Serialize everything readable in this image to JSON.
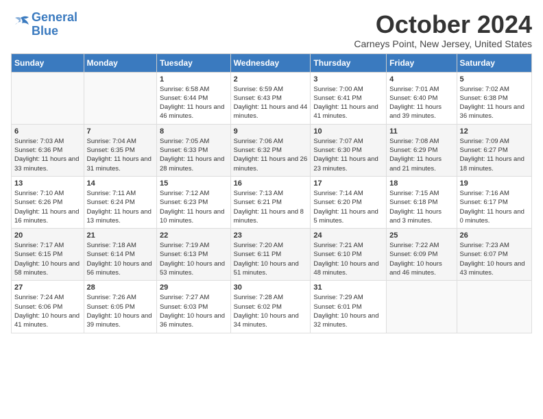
{
  "logo": {
    "line1": "General",
    "line2": "Blue"
  },
  "title": "October 2024",
  "location": "Carneys Point, New Jersey, United States",
  "days_of_week": [
    "Sunday",
    "Monday",
    "Tuesday",
    "Wednesday",
    "Thursday",
    "Friday",
    "Saturday"
  ],
  "weeks": [
    [
      {
        "day": "",
        "info": ""
      },
      {
        "day": "",
        "info": ""
      },
      {
        "day": "1",
        "info": "Sunrise: 6:58 AM\nSunset: 6:44 PM\nDaylight: 11 hours and 46 minutes."
      },
      {
        "day": "2",
        "info": "Sunrise: 6:59 AM\nSunset: 6:43 PM\nDaylight: 11 hours and 44 minutes."
      },
      {
        "day": "3",
        "info": "Sunrise: 7:00 AM\nSunset: 6:41 PM\nDaylight: 11 hours and 41 minutes."
      },
      {
        "day": "4",
        "info": "Sunrise: 7:01 AM\nSunset: 6:40 PM\nDaylight: 11 hours and 39 minutes."
      },
      {
        "day": "5",
        "info": "Sunrise: 7:02 AM\nSunset: 6:38 PM\nDaylight: 11 hours and 36 minutes."
      }
    ],
    [
      {
        "day": "6",
        "info": "Sunrise: 7:03 AM\nSunset: 6:36 PM\nDaylight: 11 hours and 33 minutes."
      },
      {
        "day": "7",
        "info": "Sunrise: 7:04 AM\nSunset: 6:35 PM\nDaylight: 11 hours and 31 minutes."
      },
      {
        "day": "8",
        "info": "Sunrise: 7:05 AM\nSunset: 6:33 PM\nDaylight: 11 hours and 28 minutes."
      },
      {
        "day": "9",
        "info": "Sunrise: 7:06 AM\nSunset: 6:32 PM\nDaylight: 11 hours and 26 minutes."
      },
      {
        "day": "10",
        "info": "Sunrise: 7:07 AM\nSunset: 6:30 PM\nDaylight: 11 hours and 23 minutes."
      },
      {
        "day": "11",
        "info": "Sunrise: 7:08 AM\nSunset: 6:29 PM\nDaylight: 11 hours and 21 minutes."
      },
      {
        "day": "12",
        "info": "Sunrise: 7:09 AM\nSunset: 6:27 PM\nDaylight: 11 hours and 18 minutes."
      }
    ],
    [
      {
        "day": "13",
        "info": "Sunrise: 7:10 AM\nSunset: 6:26 PM\nDaylight: 11 hours and 16 minutes."
      },
      {
        "day": "14",
        "info": "Sunrise: 7:11 AM\nSunset: 6:24 PM\nDaylight: 11 hours and 13 minutes."
      },
      {
        "day": "15",
        "info": "Sunrise: 7:12 AM\nSunset: 6:23 PM\nDaylight: 11 hours and 10 minutes."
      },
      {
        "day": "16",
        "info": "Sunrise: 7:13 AM\nSunset: 6:21 PM\nDaylight: 11 hours and 8 minutes."
      },
      {
        "day": "17",
        "info": "Sunrise: 7:14 AM\nSunset: 6:20 PM\nDaylight: 11 hours and 5 minutes."
      },
      {
        "day": "18",
        "info": "Sunrise: 7:15 AM\nSunset: 6:18 PM\nDaylight: 11 hours and 3 minutes."
      },
      {
        "day": "19",
        "info": "Sunrise: 7:16 AM\nSunset: 6:17 PM\nDaylight: 11 hours and 0 minutes."
      }
    ],
    [
      {
        "day": "20",
        "info": "Sunrise: 7:17 AM\nSunset: 6:15 PM\nDaylight: 10 hours and 58 minutes."
      },
      {
        "day": "21",
        "info": "Sunrise: 7:18 AM\nSunset: 6:14 PM\nDaylight: 10 hours and 56 minutes."
      },
      {
        "day": "22",
        "info": "Sunrise: 7:19 AM\nSunset: 6:13 PM\nDaylight: 10 hours and 53 minutes."
      },
      {
        "day": "23",
        "info": "Sunrise: 7:20 AM\nSunset: 6:11 PM\nDaylight: 10 hours and 51 minutes."
      },
      {
        "day": "24",
        "info": "Sunrise: 7:21 AM\nSunset: 6:10 PM\nDaylight: 10 hours and 48 minutes."
      },
      {
        "day": "25",
        "info": "Sunrise: 7:22 AM\nSunset: 6:09 PM\nDaylight: 10 hours and 46 minutes."
      },
      {
        "day": "26",
        "info": "Sunrise: 7:23 AM\nSunset: 6:07 PM\nDaylight: 10 hours and 43 minutes."
      }
    ],
    [
      {
        "day": "27",
        "info": "Sunrise: 7:24 AM\nSunset: 6:06 PM\nDaylight: 10 hours and 41 minutes."
      },
      {
        "day": "28",
        "info": "Sunrise: 7:26 AM\nSunset: 6:05 PM\nDaylight: 10 hours and 39 minutes."
      },
      {
        "day": "29",
        "info": "Sunrise: 7:27 AM\nSunset: 6:03 PM\nDaylight: 10 hours and 36 minutes."
      },
      {
        "day": "30",
        "info": "Sunrise: 7:28 AM\nSunset: 6:02 PM\nDaylight: 10 hours and 34 minutes."
      },
      {
        "day": "31",
        "info": "Sunrise: 7:29 AM\nSunset: 6:01 PM\nDaylight: 10 hours and 32 minutes."
      },
      {
        "day": "",
        "info": ""
      },
      {
        "day": "",
        "info": ""
      }
    ]
  ]
}
